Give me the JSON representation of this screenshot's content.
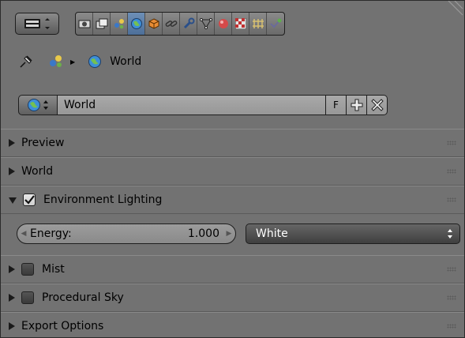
{
  "context_path": {
    "world_label": "World"
  },
  "datablock": {
    "name": "World",
    "fake_user": "F"
  },
  "panels": [
    {
      "label": "Preview",
      "expanded": false,
      "has_checkbox": false
    },
    {
      "label": "World",
      "expanded": false,
      "has_checkbox": false
    },
    {
      "label": "Environment Lighting",
      "expanded": true,
      "has_checkbox": true,
      "checked": true
    },
    {
      "label": "Mist",
      "expanded": false,
      "has_checkbox": true,
      "checked": false
    },
    {
      "label": "Procedural Sky",
      "expanded": false,
      "has_checkbox": true,
      "checked": false
    },
    {
      "label": "Export Options",
      "expanded": false,
      "has_checkbox": false
    }
  ],
  "environment_lighting": {
    "energy_label": "Energy:",
    "energy_value": "1.000",
    "color_source": "White"
  },
  "header": {
    "tabs": [
      "render-icon",
      "render-layers-icon",
      "scene-icon",
      "world-icon",
      "object-icon",
      "constraints-icon",
      "modifiers-icon",
      "data-icon",
      "material-icon",
      "texture-icon",
      "particles-icon",
      "physics-icon"
    ],
    "active_tab": "world-icon"
  },
  "colors": {
    "panel_bg": "#727272",
    "active_tab": "#5a7fab",
    "select_bg": "#4a4a4a"
  }
}
